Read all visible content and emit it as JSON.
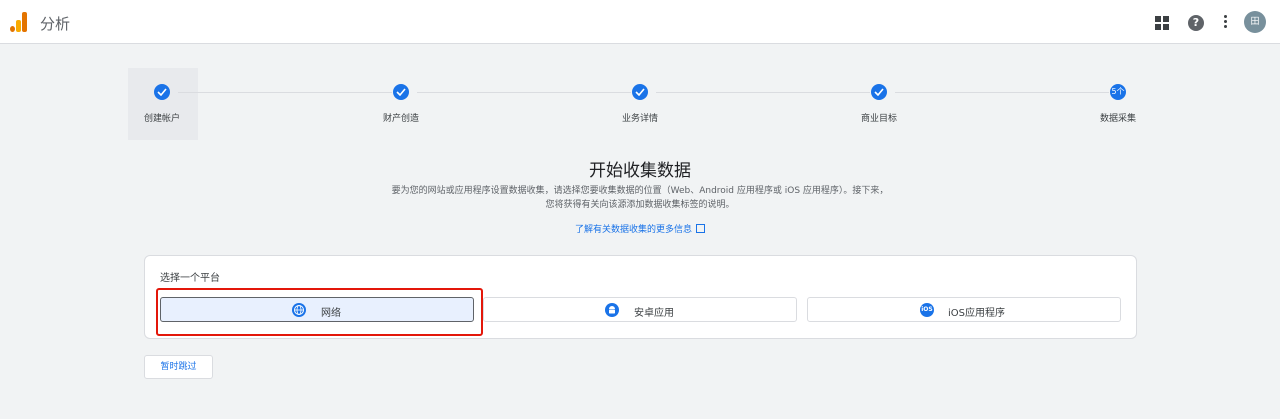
{
  "header": {
    "app_title": "分析",
    "avatar_initial": "田",
    "help_glyph": "?"
  },
  "steps": [
    {
      "label": "创建帐户",
      "status": "done"
    },
    {
      "label": "财产创造",
      "status": "done"
    },
    {
      "label": "业务详情",
      "status": "done"
    },
    {
      "label": "商业目标",
      "status": "done"
    },
    {
      "label": "数据采集",
      "status": "current",
      "number": "5个"
    }
  ],
  "main": {
    "title": "开始收集数据",
    "description_line1": "要为您的网站或应用程序设置数据收集，请选择您要收集数据的位置（Web、Android 应用程序或 iOS 应用程序）。接下来，",
    "description_line2": "您将获得有关向该源添加数据收集标签的说明。",
    "learn_more_link": "了解有关数据收集的更多信息"
  },
  "platform": {
    "section_label": "选择一个平台",
    "options": [
      {
        "label": "网络",
        "icon": "globe-icon",
        "selected": true
      },
      {
        "label": "安卓应用",
        "icon": "android-icon",
        "selected": false
      },
      {
        "label": "iOS应用程序",
        "icon": "ios-icon",
        "icon_text": "iOS",
        "selected": false
      }
    ]
  },
  "skip_button": "暂时跳过",
  "colors": {
    "accent": "#1a73e8",
    "highlight": "#e3170a",
    "logo_orange": "#e37400",
    "logo_yellow": "#f9ab00"
  }
}
